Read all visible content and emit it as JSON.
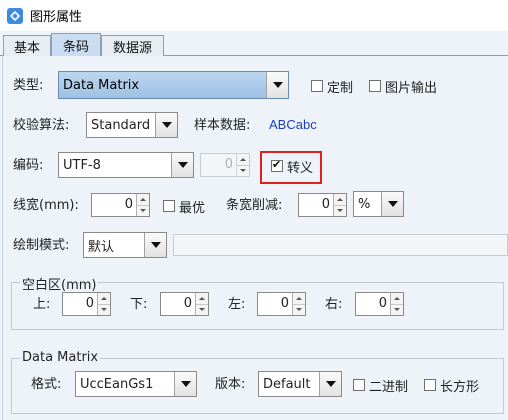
{
  "window": {
    "title": "图形属性"
  },
  "tabs": [
    {
      "label": "基本"
    },
    {
      "label": "条码"
    },
    {
      "label": "数据源"
    }
  ],
  "form": {
    "type_label": "类型:",
    "type_value": "Data Matrix",
    "custom_label": "定制",
    "image_output_label": "图片输出",
    "check_algo_label": "校验算法:",
    "check_algo_value": "Standard",
    "sample_data_label": "样本数据:",
    "sample_data_value": "ABCabc",
    "encoding_label": "编码:",
    "encoding_value": "UTF-8",
    "encoding_spin_value": "0",
    "escape_label": "转义",
    "line_width_label": "线宽(mm):",
    "line_width_value": "0",
    "optimal_label": "最优",
    "bar_reduce_label": "条宽削减:",
    "bar_reduce_value": "0",
    "bar_reduce_unit": "%",
    "draw_mode_label": "绘制模式:",
    "draw_mode_value": "默认"
  },
  "quiet_zone": {
    "title": "空白区(mm)",
    "top_label": "上:",
    "top_value": "0",
    "bottom_label": "下:",
    "bottom_value": "0",
    "left_label": "左:",
    "left_value": "0",
    "right_label": "右:",
    "right_value": "0"
  },
  "data_matrix": {
    "title": "Data Matrix",
    "format_label": "格式:",
    "format_value": "UccEanGs1",
    "version_label": "版本:",
    "version_value": "Default",
    "binary_label": "二进制",
    "rectangle_label": "长方形"
  },
  "state": {
    "custom_checked": false,
    "image_output_checked": false,
    "escape_checked": true,
    "optimal_checked": false,
    "binary_checked": false,
    "rectangle_checked": false,
    "active_tab": "条码"
  },
  "colors": {
    "highlight": "#e02020",
    "sample_text": "#1a3fbf",
    "selection": "#9fc1e4"
  }
}
